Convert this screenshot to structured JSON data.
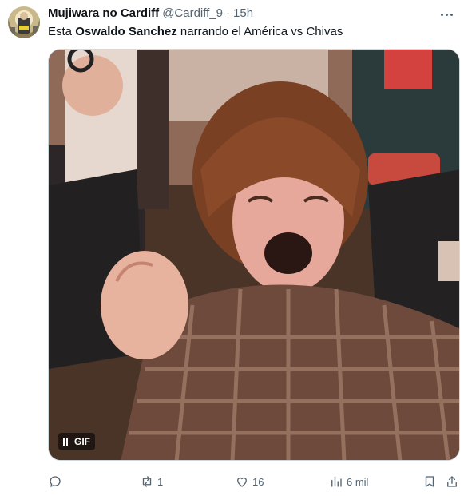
{
  "tweet": {
    "author_name": "Mujiwara no Cardiff",
    "handle": "@Cardiff_9",
    "separator": "·",
    "time": "15h",
    "text_before": "Esta ",
    "text_bold": "Oswaldo Sanchez",
    "text_after": " narrando el América vs Chivas"
  },
  "media": {
    "type_label": "GIF",
    "state": "playing"
  },
  "actions": {
    "reply_count": "",
    "retweet_count": "1",
    "like_count": "16",
    "views_count": "6 mil"
  },
  "icons": {
    "more": "more-horizontal-icon",
    "reply": "reply-icon",
    "retweet": "retweet-icon",
    "like": "heart-icon",
    "views": "views-icon",
    "bookmark": "bookmark-icon",
    "share": "share-icon"
  },
  "colors": {
    "secondary_text": "#536471",
    "primary_text": "#0f1419"
  }
}
